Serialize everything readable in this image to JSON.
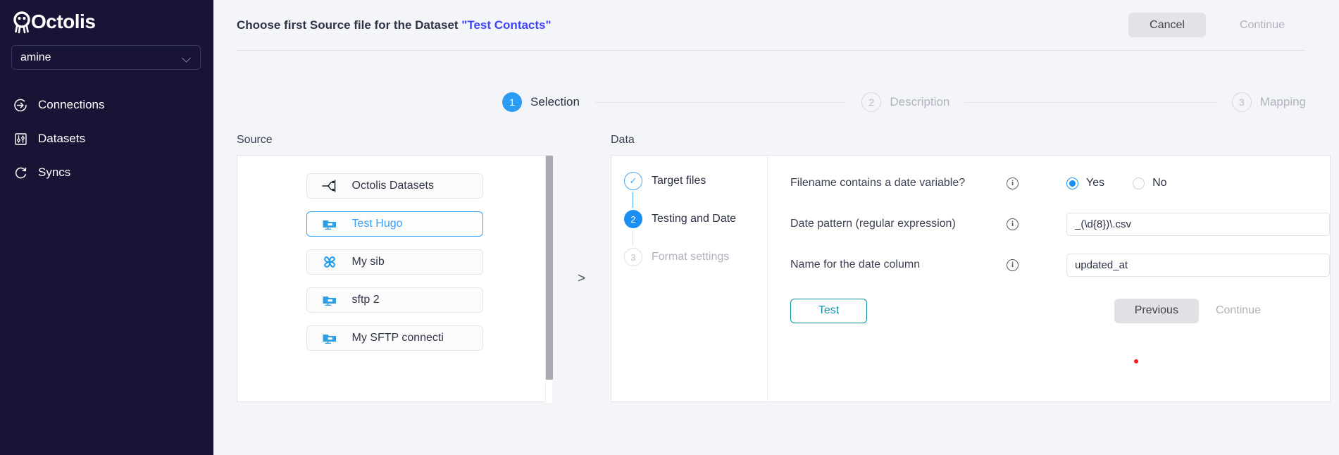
{
  "sidebar": {
    "brand": "Octolis",
    "logo_icon": "octopus-logo-icon",
    "workspace": {
      "value": "amine",
      "chevron_icon": "chevron-down-icon"
    },
    "items": [
      {
        "label": "Connections",
        "icon": "arrow-into-circle-icon"
      },
      {
        "label": "Datasets",
        "icon": "sliders-square-icon"
      },
      {
        "label": "Syncs",
        "icon": "refresh-circle-icon"
      }
    ]
  },
  "topbar": {
    "title_prefix": "Choose first Source file for the Dataset ",
    "dataset_name": "\"Test Contacts\"",
    "cancel_label": "Cancel",
    "continue_label": "Continue"
  },
  "stepper": {
    "steps": [
      {
        "number": "1",
        "label": "Selection",
        "state": "active"
      },
      {
        "number": "2",
        "label": "Description",
        "state": "idle"
      },
      {
        "number": "3",
        "label": "Mapping",
        "state": "idle"
      }
    ]
  },
  "source": {
    "heading": "Source",
    "items": [
      {
        "label": "Octolis Datasets",
        "icon": "octolis-datasets-icon",
        "selected": false
      },
      {
        "label": "Test Hugo",
        "icon": "sftp-folder-icon",
        "selected": true
      },
      {
        "label": "My sib",
        "icon": "sendinblue-icon",
        "selected": false
      },
      {
        "label": "sftp 2",
        "icon": "sftp-folder-icon",
        "selected": false
      },
      {
        "label": "My SFTP connecti",
        "icon": "sftp-folder-icon",
        "selected": false
      }
    ],
    "scrollbar": "vertical-scrollbar"
  },
  "arrow": {
    "glyph": ">",
    "icon": "chevron-right-icon"
  },
  "data": {
    "heading": "Data",
    "substeps": [
      {
        "number": "✓",
        "label": "Target files",
        "state": "done"
      },
      {
        "number": "2",
        "label": "Testing and Date",
        "state": "active"
      },
      {
        "number": "3",
        "label": "Format settings",
        "state": "idle"
      }
    ],
    "fields": [
      {
        "label": "Filename contains a date variable?",
        "info_icon": "info-icon",
        "type": "radio",
        "options": [
          {
            "label": "Yes",
            "checked": true
          },
          {
            "label": "No",
            "checked": false
          }
        ]
      },
      {
        "label": "Date pattern (regular expression)",
        "info_icon": "info-icon",
        "type": "text",
        "value": "_(\\d{8})\\.csv",
        "placeholder": ""
      },
      {
        "label": "Name for the date column",
        "info_icon": "info-icon",
        "type": "text",
        "value": "updated_at",
        "placeholder": ""
      }
    ],
    "footer": {
      "test_label": "Test",
      "previous_label": "Previous",
      "continue_label": "Continue",
      "status_dot": "error-dot-indicator"
    }
  },
  "colors": {
    "sidebar_bg": "#171435",
    "accent_blue": "#1b8ff0",
    "link_blue": "#3e44ff",
    "teal": "#0b8fa0",
    "error_red": "#f51b1b",
    "page_bg": "#f4f5f9"
  }
}
